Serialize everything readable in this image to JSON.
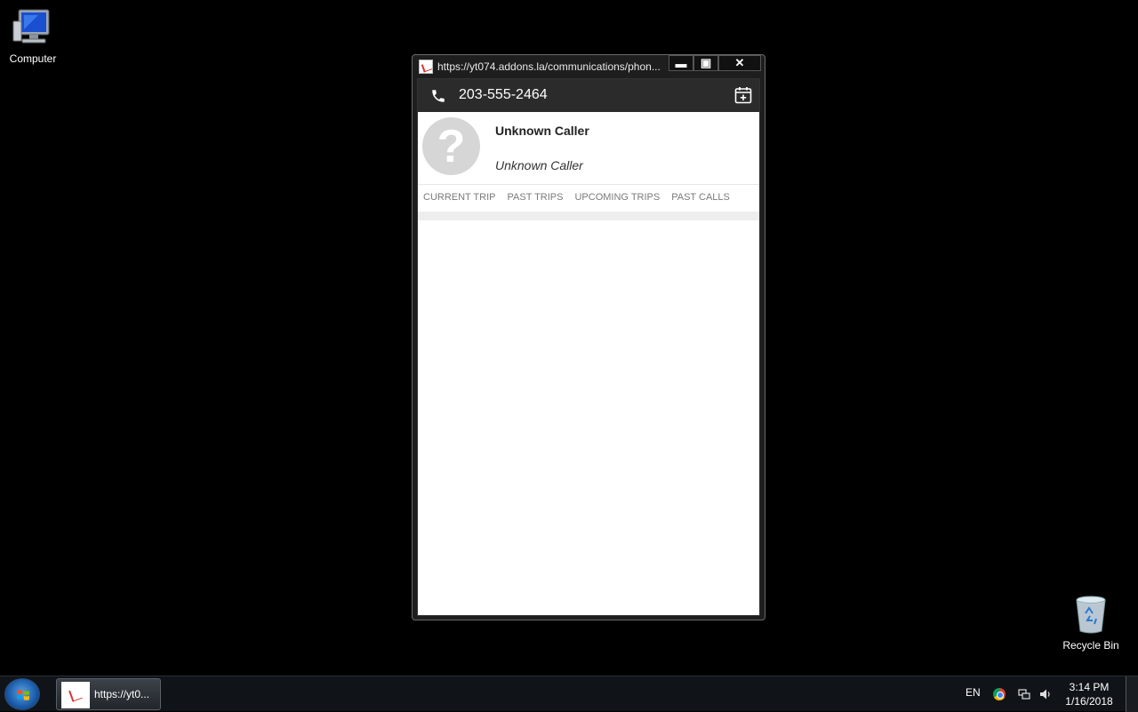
{
  "desktop": {
    "icons": [
      {
        "label": "Computer",
        "icon": "computer-icon"
      },
      {
        "label": "Recycle Bin",
        "icon": "recycle-bin-icon"
      }
    ]
  },
  "window": {
    "url": "https://yt074.addons.la/communications/phon...",
    "controls": {
      "minimize": "▬",
      "maximize": "▣",
      "close": "✕"
    }
  },
  "call": {
    "phone_number": "203-555-2464",
    "caller_name": "Unknown Caller",
    "caller_subtitle": "Unknown Caller",
    "avatar_glyph": "?"
  },
  "tabs": [
    {
      "label": "CURRENT TRIP"
    },
    {
      "label": "PAST TRIPS"
    },
    {
      "label": "UPCOMING TRIPS"
    },
    {
      "label": "PAST CALLS"
    }
  ],
  "taskbar": {
    "task_label": "https://yt0...",
    "language": "EN",
    "time": "3:14 PM",
    "date": "1/16/2018"
  },
  "colors": {
    "callbar": "#2b2b2b",
    "avatar": "#d6d6d6",
    "tab_text": "#7a7a7a"
  }
}
